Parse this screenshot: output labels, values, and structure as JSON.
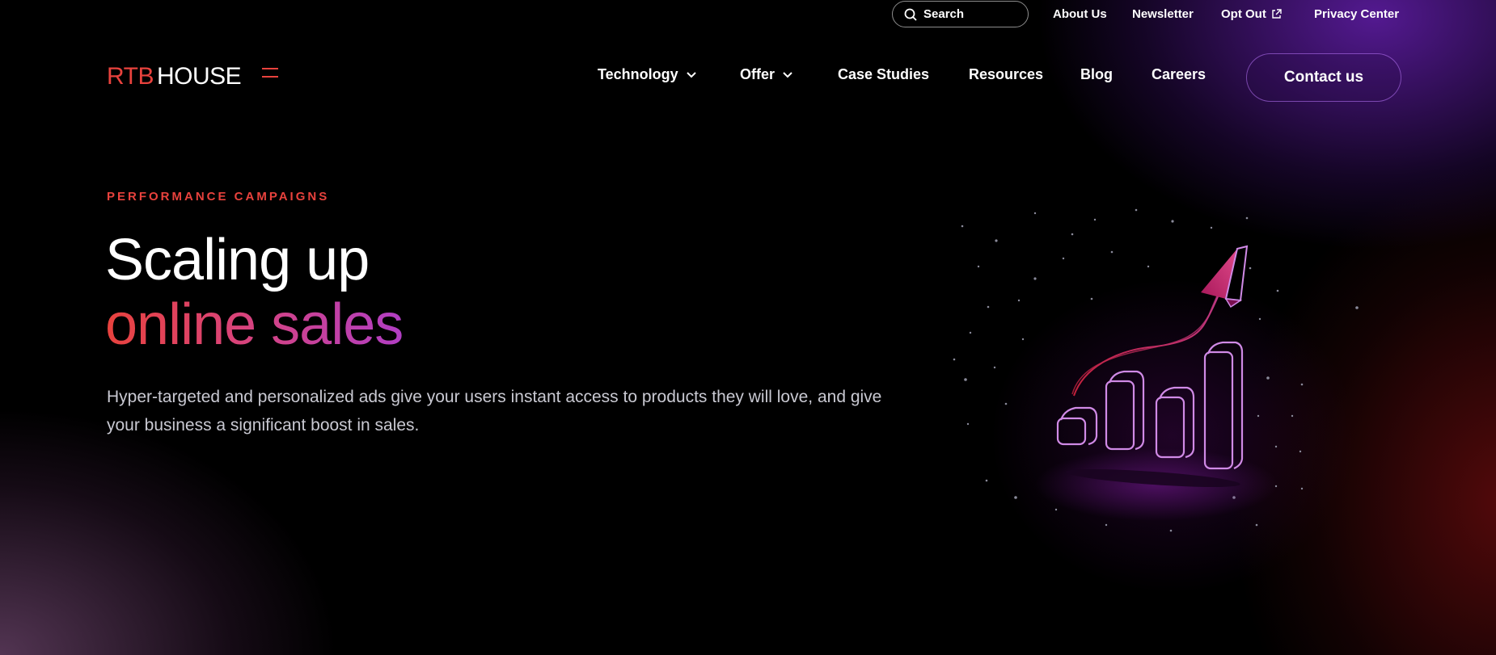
{
  "utility": {
    "search_label": "Search",
    "links": [
      "About Us",
      "Newsletter",
      "Opt Out",
      "Privacy Center"
    ]
  },
  "brand": {
    "part1": "RTB",
    "part2": "HOUSE"
  },
  "nav": {
    "items": [
      "Technology",
      "Offer",
      "Case Studies",
      "Resources",
      "Blog",
      "Careers"
    ],
    "contact_label": "Contact us"
  },
  "hero": {
    "eyebrow": "PERFORMANCE CAMPAIGNS",
    "title_line1": "Scaling up",
    "title_line2": "online sales",
    "description": "Hyper-targeted and personalized ads give your users instant access to products they will love, and give your business a significant boost in sales."
  },
  "colors": {
    "brand_red": "#e8423d",
    "gradient_end": "#b13ec4",
    "illustration_stroke": "#d08ae6"
  },
  "icons": {
    "search": "search-icon",
    "external": "external-link-icon",
    "chevron": "chevron-down-icon",
    "menu": "menu-icon"
  }
}
